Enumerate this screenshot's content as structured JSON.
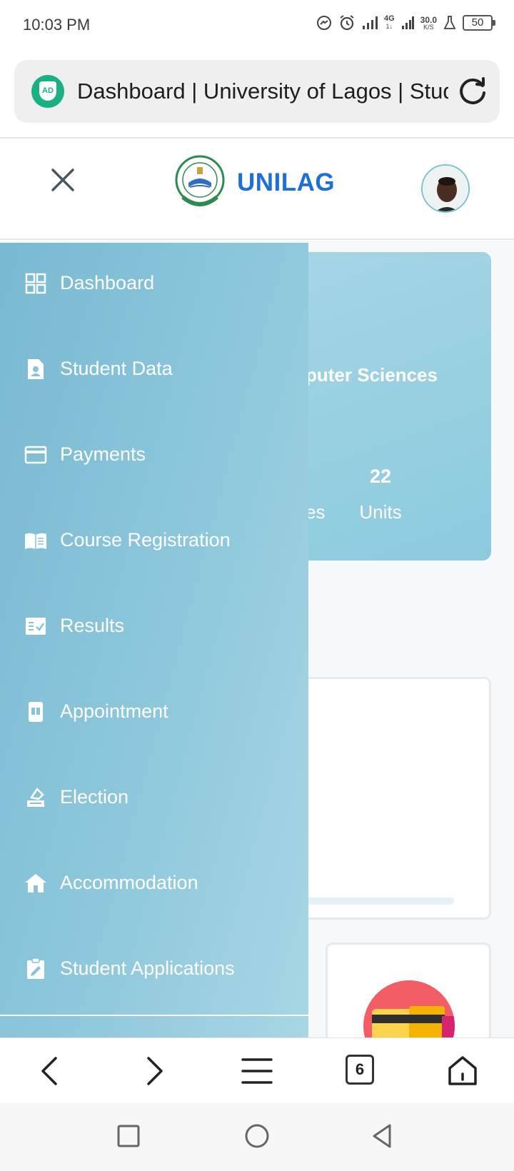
{
  "status_bar": {
    "time": "10:03 PM",
    "network": "4G",
    "network_sub": "1↓",
    "speed": "30.0",
    "speed_unit": "K/S",
    "battery": "50",
    "icons": [
      "messenger-icon",
      "alarm-icon",
      "signal-icon",
      "signal-4g-icon",
      "lab-icon",
      "battery-icon"
    ]
  },
  "browser": {
    "tab_title": "Dashboard | University of Lagos | Student Portal",
    "adblock_label": "AD",
    "tab_count": "6"
  },
  "header": {
    "brand": "UNILAG"
  },
  "side_menu": {
    "items": [
      {
        "label": "Dashboard",
        "icon": "grid-icon"
      },
      {
        "label": "Student Data",
        "icon": "student-file-icon"
      },
      {
        "label": "Payments",
        "icon": "credit-card-icon"
      },
      {
        "label": "Course Registration",
        "icon": "open-book-icon"
      },
      {
        "label": "Results",
        "icon": "checklist-icon"
      },
      {
        "label": "Appointment",
        "icon": "calendar-icon"
      },
      {
        "label": "Election",
        "icon": "ballot-icon"
      },
      {
        "label": "Accommodation",
        "icon": "house-icon"
      },
      {
        "label": "Student Applications",
        "icon": "clipboard-edit-icon"
      }
    ]
  },
  "dashboard": {
    "faculty_fragment": "puter Sciences",
    "courses_fragment": "es",
    "units_value": "22",
    "units_label": "Units"
  },
  "colors": {
    "menu_bg": "#8cc6da",
    "brand": "#1e6fd9",
    "adblock": "#19b083"
  }
}
